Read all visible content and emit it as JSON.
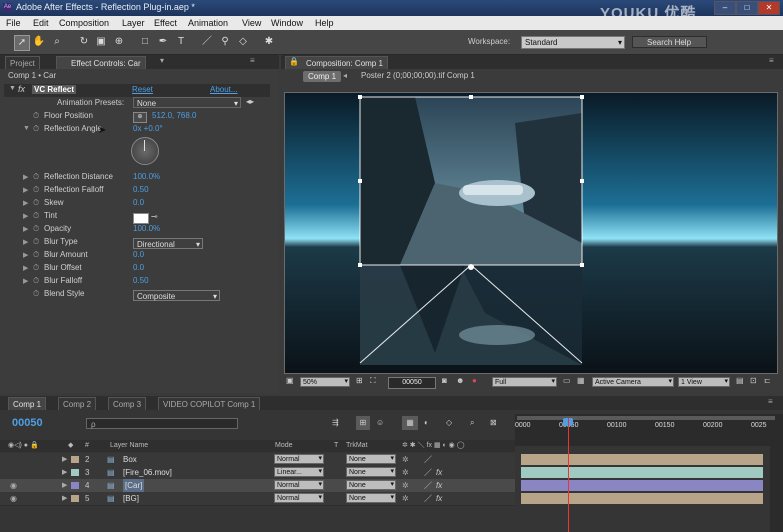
{
  "window": {
    "title": "Adobe After Effects - Reflection Plug-in.aep *",
    "app_badge": "Ae",
    "minimize": "–",
    "maximize": "□",
    "close": "✕"
  },
  "watermark": "YOUKU 优酷",
  "menu": [
    "File",
    "Edit",
    "Composition",
    "Layer",
    "Effect",
    "Animation",
    "View",
    "Window",
    "Help"
  ],
  "toolbar": {
    "workspace_label": "Workspace:",
    "workspace_value": "Standard",
    "search_placeholder": "Search Help"
  },
  "left_panel": {
    "tabs": [
      "Project",
      "Effect Controls: Car"
    ],
    "breadcrumb": "Comp 1 • Car",
    "effect_name": "VC Reflect",
    "reset": "Reset",
    "about": "About...",
    "animation_presets_label": "Animation Presets:",
    "animation_presets_value": "None",
    "props": [
      {
        "label": "Floor Position",
        "value": "512.0, 768.0"
      },
      {
        "label": "Reflection Angle",
        "value": "0x +0.0°"
      },
      {
        "label": "Reflection Distance",
        "value": "100.0%"
      },
      {
        "label": "Reflection Falloff",
        "value": "0.50"
      },
      {
        "label": "Skew",
        "value": "0.0"
      },
      {
        "label": "Tint",
        "value": ""
      },
      {
        "label": "Opacity",
        "value": "100.0%"
      },
      {
        "label": "Blur Type",
        "value": "Directional"
      },
      {
        "label": "Blur Amount",
        "value": "0.0"
      },
      {
        "label": "Blur Offset",
        "value": "0.0"
      },
      {
        "label": "Blur Falloff",
        "value": "0.50"
      },
      {
        "label": "Blend Style",
        "value": "Composite"
      }
    ]
  },
  "comp_panel": {
    "tab": "Composition: Comp 1",
    "breadcrumb_comp": "Comp 1",
    "breadcrumb_item": "Poster 2 (0;00;00;00).tif Comp 1",
    "zoom": "50%",
    "timecode": "00050",
    "resolution": "Full",
    "camera": "Active Camera",
    "view": "1 View"
  },
  "timeline": {
    "tabs": [
      "Comp 1",
      "Comp 2",
      "Comp 3",
      "VIDEO COPILOT Comp 1"
    ],
    "current_time": "00050",
    "search_placeholder": "ρ",
    "headers": {
      "num": "#",
      "layer_name": "Layer Name",
      "mode": "Mode",
      "t": "T",
      "trkmat": "TrkMat"
    },
    "ruler": [
      "0000",
      "00050",
      "00100",
      "00150",
      "00200",
      "0025"
    ],
    "layers": [
      {
        "num": "2",
        "name": "Box",
        "mode": "Normal",
        "trkmat": "None",
        "color": "#b8a488"
      },
      {
        "num": "3",
        "name": "[Fire_06.mov]",
        "mode": "Linear...",
        "trkmat": "None",
        "color": "#9fc9c1"
      },
      {
        "num": "4",
        "name": "[Car]",
        "mode": "Normal",
        "trkmat": "None",
        "color": "#8a86c4"
      },
      {
        "num": "5",
        "name": "[BG]",
        "mode": "Normal",
        "trkmat": "None",
        "color": "#b8a488"
      }
    ]
  }
}
